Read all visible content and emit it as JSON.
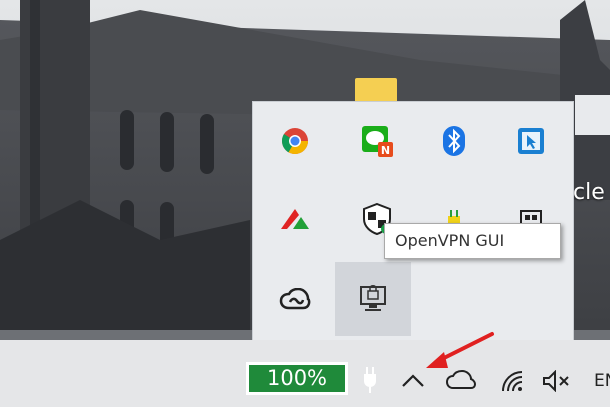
{
  "desktop": {
    "background": "castle wallpaper",
    "partial_text": "cle"
  },
  "tray_flyout": {
    "icons": [
      {
        "name": "chrome-icon"
      },
      {
        "name": "chat-notification-icon"
      },
      {
        "name": "bluetooth-icon"
      },
      {
        "name": "remote-app-icon"
      },
      {
        "name": "red-green-logo-icon"
      },
      {
        "name": "windows-defender-icon"
      },
      {
        "name": "plug-status-icon"
      },
      {
        "name": "network-device-icon"
      },
      {
        "name": "creative-cloud-icon"
      },
      {
        "name": "openvpn-icon"
      }
    ],
    "hovered_icon": "openvpn-icon"
  },
  "tooltip": {
    "text": "OpenVPN GUI"
  },
  "taskbar": {
    "battery_percent": "100%",
    "battery_color": "#1f8a3a",
    "language": "EN"
  },
  "annotation": {
    "arrow_color": "#e02020"
  }
}
